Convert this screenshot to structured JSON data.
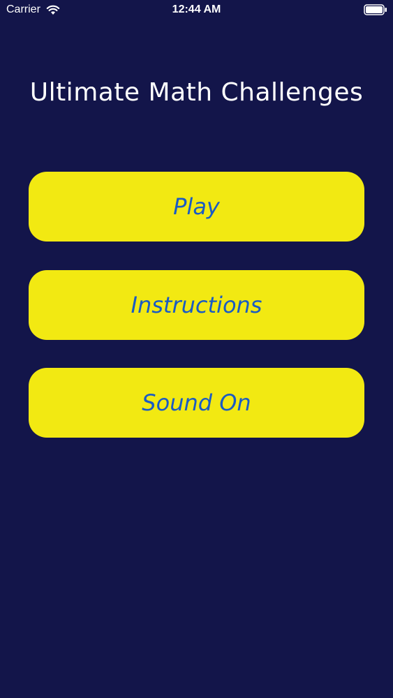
{
  "status_bar": {
    "carrier": "Carrier",
    "time": "12:44 AM",
    "wifi_icon": "wifi-icon",
    "battery_icon": "battery-icon"
  },
  "title": "Ultimate Math Challenges",
  "menu": {
    "play_label": "Play",
    "instructions_label": "Instructions",
    "sound_label": "Sound On"
  },
  "colors": {
    "background": "#13154a",
    "button_fill": "#f2e912",
    "button_text": "#1a5bc4",
    "title_text": "#ffffff"
  }
}
